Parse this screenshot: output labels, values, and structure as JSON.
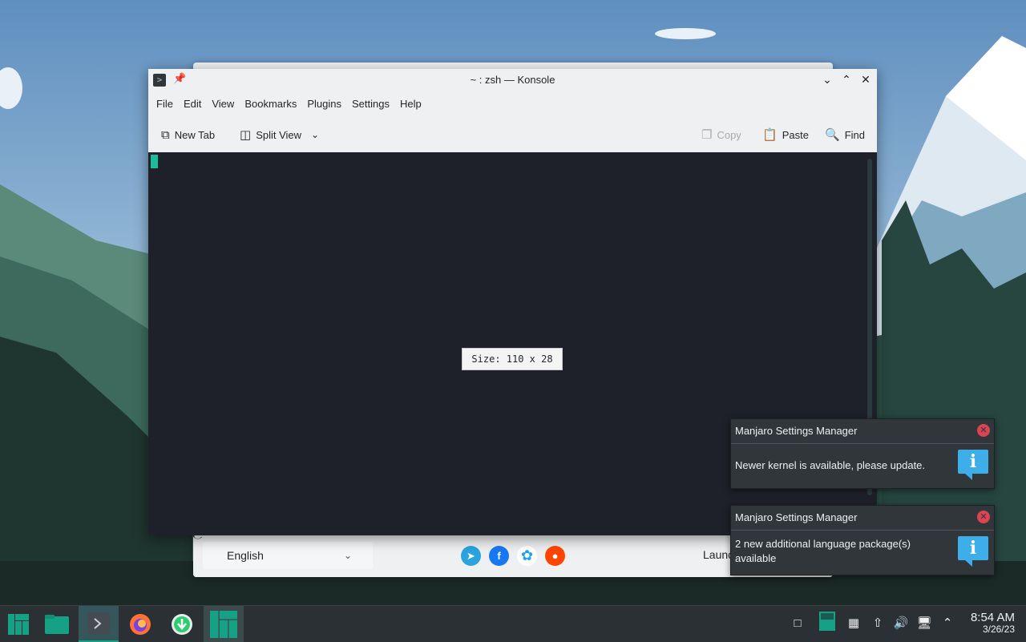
{
  "konsole": {
    "title": "~ : zsh — Konsole",
    "menu": [
      "File",
      "Edit",
      "View",
      "Bookmarks",
      "Plugins",
      "Settings",
      "Help"
    ],
    "toolbar": {
      "new_tab": "New Tab",
      "split_view": "Split View",
      "copy": "Copy",
      "paste": "Paste",
      "find": "Find"
    },
    "size_indicator": "Size: 110 x 28"
  },
  "welcome": {
    "language": "English",
    "launch_label": "Launc",
    "social": [
      "telegram-icon",
      "facebook-icon",
      "twitter-icon",
      "reddit-icon"
    ]
  },
  "notifications": [
    {
      "title": "Manjaro Settings Manager",
      "body": "Newer kernel is available, please update."
    },
    {
      "title": "Manjaro Settings Manager",
      "body": "2 new additional language package(s) available"
    }
  ],
  "taskbar": {
    "time": "8:54 AM",
    "date": "3/26/23"
  },
  "colors": {
    "terminal_bg": "#1e202a",
    "cursor": "#1abc9c",
    "accent": "#16a085",
    "info_blue": "#3daee9",
    "close_red": "#da4453"
  }
}
